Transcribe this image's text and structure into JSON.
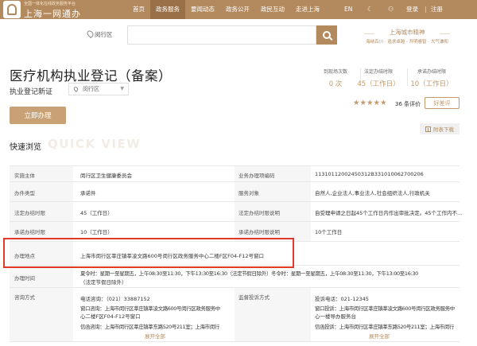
{
  "header": {
    "brand_sub": "全国一体化在线政务服务平台",
    "brand_main": "上海一网通办",
    "nav": [
      "首页",
      "政务服务",
      "要闻动态",
      "政务公开",
      "政民互动",
      "走进上海"
    ],
    "nav_active_index": 1,
    "lang": "EN",
    "login": "登录",
    "sep": "|",
    "register": "注册"
  },
  "search": {
    "location": "闵行区",
    "placeholder": "",
    "slogan_main": "上海城市精神",
    "slogan_sub": "海纳百川 · 追求卓越 · 开明睿智 · 大气谦和"
  },
  "service": {
    "title": "医疗机构执业登记（备案）",
    "subtitle": "执业登记新证",
    "region": "闵行区",
    "apply_label": "立即办理",
    "stats": [
      {
        "label": "到现场次数",
        "value": "0 次"
      },
      {
        "label": "法定办结时限",
        "value": "45（工作日）"
      },
      {
        "label": "承诺办结时限",
        "value": "10（工作日）"
      }
    ],
    "stars": "★★★★★",
    "rating_value": 5,
    "review_count": "36 条评价",
    "review_btn": "好差评",
    "download": "附表下载"
  },
  "quickview": {
    "title": "快速浏览",
    "watermark": "QUICK VIEW",
    "rows": [
      {
        "l1": "实施主体",
        "v1": "闵行区卫生健康委员会",
        "l2": "业务办理项编码",
        "v2": "11310112002450312B331010062700206"
      },
      {
        "l1": "办件类型",
        "v1": "承诺件",
        "l2": "服务对象",
        "v2": "自然人,企业法人,事业法人,社会组织法人,行政机关"
      },
      {
        "l1": "法定办结时限",
        "v1": "45（工作日）",
        "l2": "法定办结时限说明",
        "v2": "自受理申请之日起45个工作日内作出审批决定。45个工作内不..."
      },
      {
        "l1": "承诺办结时限",
        "v1": "10（工作日）",
        "l2": "承诺办结时限说明",
        "v2": "10个工作日"
      },
      {
        "l1": "办理地点",
        "v1": "上海市闵行区莘庄镇莘凌文路600号闵行区政务服务中心二楼F区F04-F12号窗口"
      },
      {
        "l1": "办理时间",
        "v1a": "夏令时：星期一至星期五，上午08:30至11:30，下午13:30至16:30（法定节假日除外）冬令时：星期一至星期五，上午08:30至11:30，下午13:00至16:30",
        "v1b": "（法定节假日除外）"
      },
      {
        "l1": "咨询方式",
        "c_phone": "电话咨询：（021）33887152",
        "c_window_a": "窗口咨询：上海市闵行区莘庄镇莘凌文路600号闵行区政务服务中",
        "c_window_b": "心二楼F区F04-F12号窗口",
        "c_letter": "信函咨询：上海市闵行区莘庄镇莘东路520号211室；上海市闵行",
        "c_expand": "展开全部",
        "l2": "监督投诉方式",
        "s_phone": "投诉电话：021-12345",
        "s_window_a": "窗口投诉：上海市闵行区莘庄镇莘凌文路600号闵行区政务服务中",
        "s_window_b": "心一楼导办服务台",
        "s_letter": "信函投诉：上海市闵行区莘庄镇莘东路520号211室；上海市闵行",
        "s_expand": "展开全部"
      }
    ]
  },
  "colors": {
    "brand": "#b38a5e",
    "accent": "#c49a6c",
    "highlight": "#e23a2a"
  }
}
